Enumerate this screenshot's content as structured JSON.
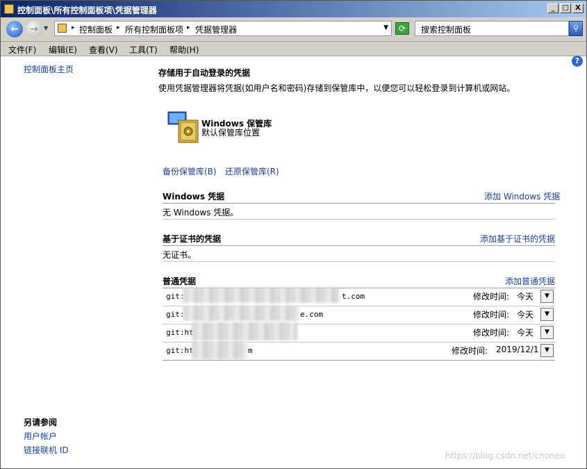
{
  "window": {
    "title": "控制面板\\所有控制面板项\\凭据管理器",
    "min": "_",
    "max": "□",
    "close": "X"
  },
  "address": {
    "crumb1": "控制面板",
    "crumb2": "所有控制面板项",
    "crumb3": "凭据管理器",
    "search_placeholder": "搜索控制面板"
  },
  "menu": {
    "file": "文件(F)",
    "edit": "编辑(E)",
    "view": "查看(V)",
    "tools": "工具(T)",
    "help": "帮助(H)"
  },
  "sidebar": {
    "home": "控制面板主页",
    "see_also": "另请参阅",
    "user_accounts": "用户帐户",
    "link_online_id": "链接联机 ID"
  },
  "main": {
    "title": "存储用于自动登录的凭据",
    "description": "使用凭据管理器将凭据(如用户名和密码)存储到保管库中，以便您可以轻松登录到计算机或网站。",
    "vault_name": "Windows 保管库",
    "vault_sub": "默认保管库位置",
    "backup": "备份保管库(B)",
    "restore": "还原保管库(R)"
  },
  "sections": {
    "windows": {
      "title": "Windows 凭据",
      "add": "添加 Windows 凭据",
      "empty": "无 Windows 凭据。"
    },
    "cert": {
      "title": "基于证书的凭据",
      "add": "添加基于证书的凭据",
      "empty": "无证书。"
    },
    "generic": {
      "title": "普通凭据",
      "add": "添加普通凭据"
    }
  },
  "credentials": [
    {
      "prefix": "git:",
      "suffix": "t.com",
      "time_label": "修改时间:",
      "time": "今天"
    },
    {
      "prefix": "git:",
      "suffix": "e.com",
      "time_label": "修改时间:",
      "time": "今天"
    },
    {
      "prefix": "git:ht",
      "suffix": "",
      "time_label": "修改时间:",
      "time": "今天"
    },
    {
      "prefix": "git:ht",
      "suffix": "m",
      "time_label": "修改时间:",
      "time": "2019/12/1"
    }
  ],
  "watermark": "https://blog.csdn.net/cnoneo"
}
